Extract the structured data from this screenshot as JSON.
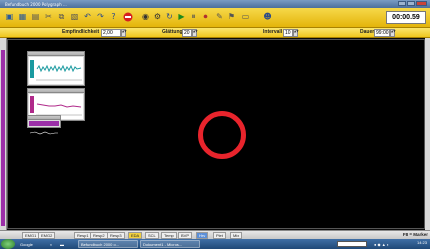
{
  "window": {
    "title": "Befundbuch 2000 Polygraph ...",
    "title_color": "#4c6f9c"
  },
  "toolbar": {
    "icons": [
      "open-icon",
      "save-icon",
      "print-icon",
      "cut-icon",
      "copy-icon",
      "paste-icon",
      "undo-icon",
      "redo-icon",
      "help-icon",
      "stop-icon",
      "eye-icon",
      "settings-icon",
      "refresh-icon",
      "play-icon",
      "pause-icon",
      "record-icon",
      "marker-icon",
      "flag-icon",
      "window-icon",
      "user-icon"
    ],
    "clock": "00:00.59",
    "accent": "#efc61e"
  },
  "settings": {
    "sensitivity_label": "Empfindlichkeit",
    "sensitivity_value": "2,00",
    "smoothing_label": "Glättung",
    "smoothing_value": "20",
    "interval_label": "Intervall",
    "interval_value": "10",
    "duration_label": "Dauer",
    "duration_value": "99:00"
  },
  "panels": [
    {
      "name": "waveform-panel-1",
      "trace_color": "#1a9aa0"
    },
    {
      "name": "waveform-panel-2",
      "trace_color": "#b02a8a"
    },
    {
      "name": "waveform-panel-3",
      "trace_color": "#9b2fa8"
    }
  ],
  "highlight_color": "#e8242c",
  "bottom_toolbar": {
    "buttons": [
      "EMG1",
      "EMG2",
      "Resp1",
      "Resp2",
      "Resp3",
      "EDA",
      "SCL",
      "Temp",
      "BVP",
      "Hrv",
      "Plet",
      "Mix"
    ],
    "active_index": 8,
    "marker_label": "F8 = Marker"
  },
  "taskbar": {
    "items": [
      "Google",
      "Befundbuch 2000 o...",
      "Dokument1 - Micros..."
    ],
    "time": "14:23"
  }
}
